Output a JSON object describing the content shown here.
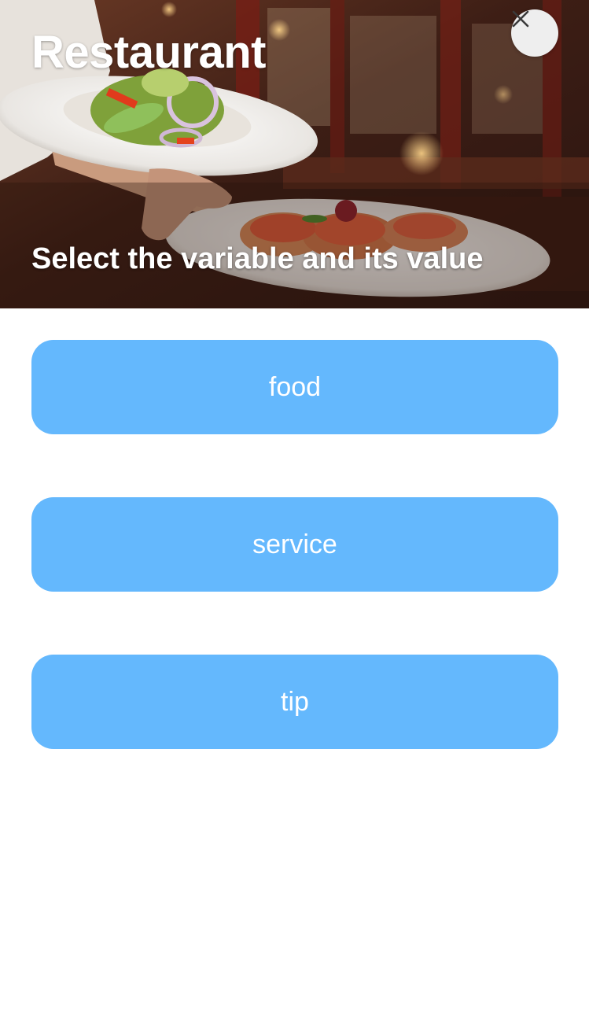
{
  "header": {
    "title": "Restaurant",
    "subtitle": "Select the variable and its value",
    "close_icon": "close-icon",
    "background": "restaurant-photo"
  },
  "options": [
    {
      "label": "food"
    },
    {
      "label": "service"
    },
    {
      "label": "tip"
    }
  ],
  "colors": {
    "button_background": "#64b8fd",
    "button_text": "#ffffff",
    "close_button_background": "#eeeeee",
    "page_background": "#ffffff"
  }
}
